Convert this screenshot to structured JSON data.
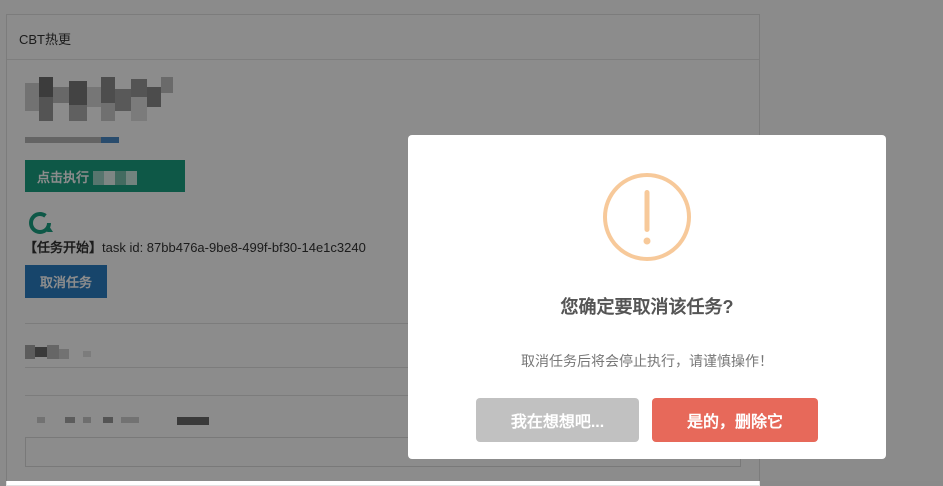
{
  "panel": {
    "title": "CBT热更"
  },
  "run_button": {
    "label": "点击执行"
  },
  "task": {
    "prefix": "【任务开始】",
    "text": "task id: 87bb476a-9be8-499f-bf30-14e1c3240"
  },
  "cancel_task_button": {
    "label": "取消任务"
  },
  "dialog": {
    "title": "您确定要取消该任务?",
    "message": "取消任务后将会停止执行，请谨慎操作！",
    "cancel_label": "我在想想吧...",
    "confirm_label": "是的，删除它"
  },
  "colors": {
    "warning": "#f7c99a",
    "confirm": "#e7695a",
    "cancel": "#c1c1c1",
    "run": "#1aa082",
    "cancel_task": "#2a7fc4"
  },
  "icons": {
    "warning": "warning-icon",
    "spinner": "refresh-spinner-icon"
  }
}
